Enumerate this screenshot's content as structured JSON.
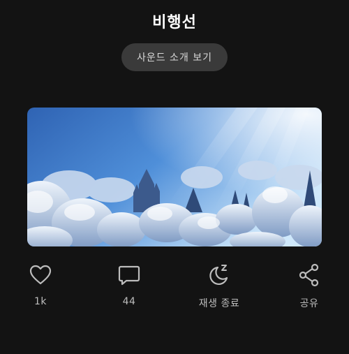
{
  "track": {
    "title": "비행선",
    "sound_intro_label": "사운드 소개 보기",
    "cover_alt": "구름 위의 성"
  },
  "actions": {
    "like_count": "1k",
    "comment_count": "44",
    "sleep_timer_label": "재생 종료",
    "share_label": "공유"
  },
  "colors": {
    "background": "#131313",
    "button_bg": "#3a3a3a",
    "icon": "#bdbdbd"
  },
  "icons": [
    "heart-icon",
    "comment-icon",
    "sleep-timer-icon",
    "share-icon"
  ]
}
